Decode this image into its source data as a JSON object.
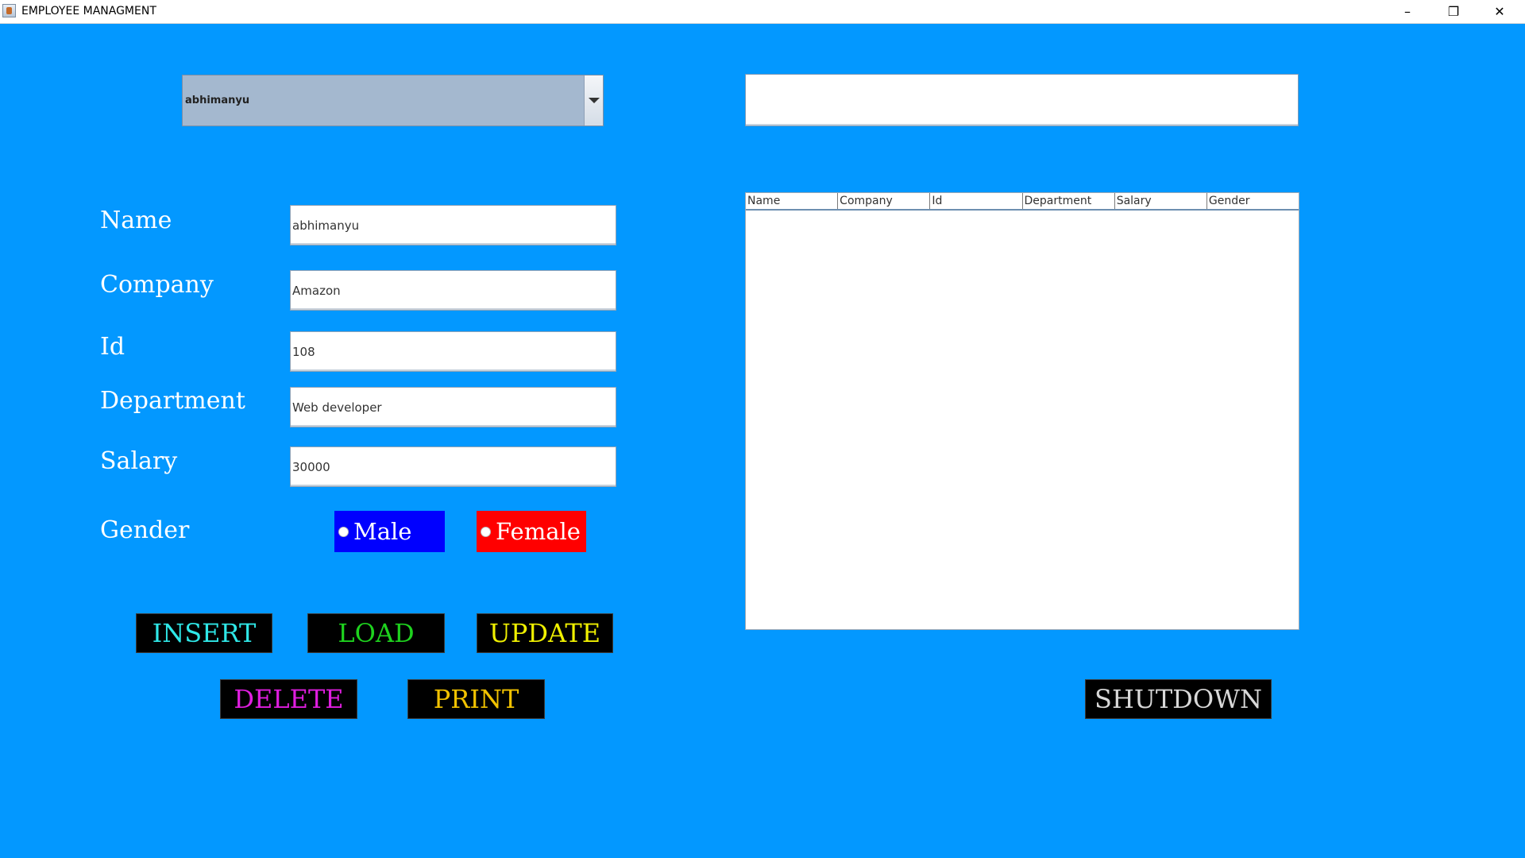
{
  "window": {
    "title": "EMPLOYEE MANAGMENT",
    "minimize": "–",
    "restore": "❐",
    "close": "✕"
  },
  "selector": {
    "value": "abhimanyu"
  },
  "search": {
    "value": ""
  },
  "form": {
    "name_label": "Name",
    "company_label": "Company",
    "id_label": "Id",
    "department_label": "Department",
    "salary_label": "Salary",
    "gender_label": "Gender",
    "name_value": "abhimanyu",
    "company_value": "Amazon",
    "id_value": "108",
    "department_value": "Web developer",
    "salary_value": "30000"
  },
  "gender": {
    "male_label": "Male",
    "female_label": "Female",
    "male_color": "#0000ff",
    "female_color": "#ff0000"
  },
  "buttons": {
    "insert": "INSERT",
    "load": "LOAD",
    "update": "UPDATE",
    "delete": "DELETE",
    "print": "PRINT",
    "shutdown": "SHUTDOWN"
  },
  "button_colors": {
    "insert": "#2fe7e7",
    "load": "#1ed21e",
    "update": "#f0f000",
    "delete": "#e01ee0",
    "print": "#f2c200",
    "shutdown": "#d8d8d8"
  },
  "table": {
    "columns": [
      "Name",
      "Company",
      "Id",
      "Department",
      "Salary",
      "Gender"
    ]
  },
  "colors": {
    "background": "#0398ff"
  }
}
